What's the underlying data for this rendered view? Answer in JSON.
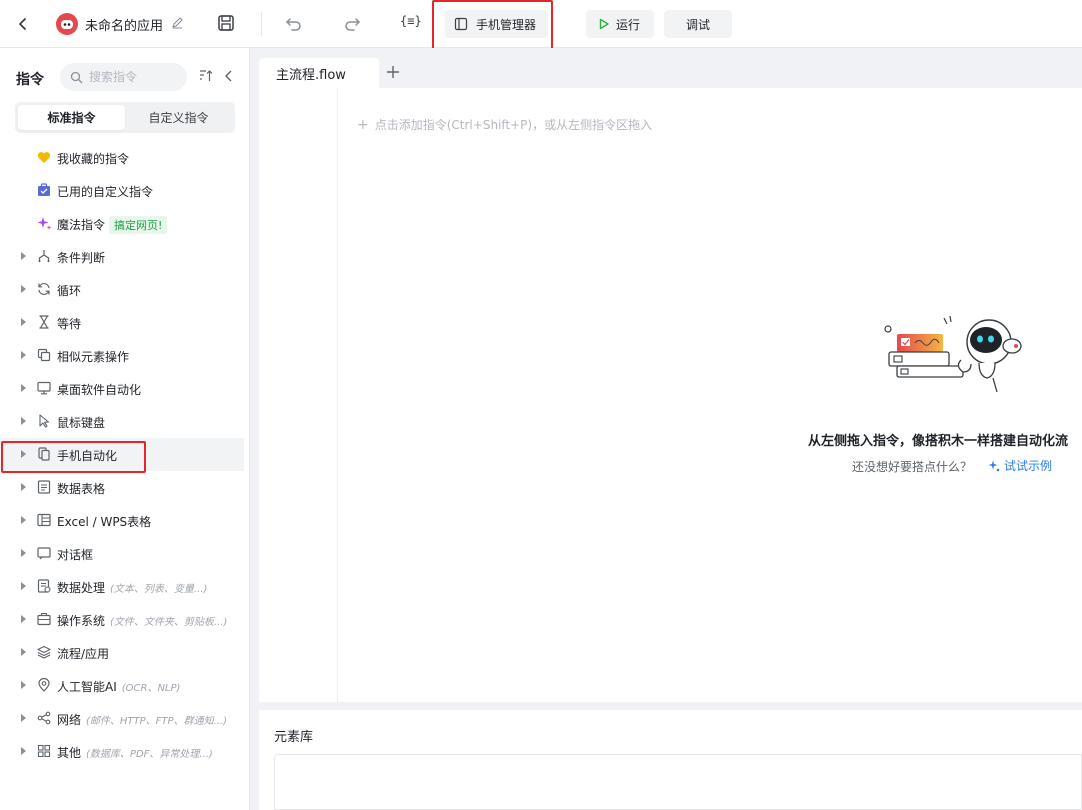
{
  "toolbar": {
    "app_title": "未命名的应用",
    "variables_label": "{≡}",
    "phone_manager_label": "手机管理器",
    "run_label": "运行",
    "debug_label": "调试"
  },
  "sidebar": {
    "title": "指令",
    "search_placeholder": "搜索指令",
    "tabs": [
      "标准指令",
      "自定义指令"
    ],
    "items": [
      {
        "label": "我收藏的指令",
        "icon": "heart-icon"
      },
      {
        "label": "已用的自定义指令",
        "icon": "briefcase-icon"
      },
      {
        "label": "魔法指令",
        "icon": "sparkle-icon",
        "badge": "搞定网页!"
      },
      {
        "label": "条件判断",
        "icon": "branch-icon"
      },
      {
        "label": "循环",
        "icon": "loop-icon"
      },
      {
        "label": "等待",
        "icon": "hourglass-icon"
      },
      {
        "label": "相似元素操作",
        "icon": "copy-icon"
      },
      {
        "label": "桌面软件自动化",
        "icon": "monitor-icon"
      },
      {
        "label": "鼠标键盘",
        "icon": "cursor-icon"
      },
      {
        "label": "手机自动化",
        "icon": "phone-copy-icon"
      },
      {
        "label": "数据表格",
        "icon": "document-icon"
      },
      {
        "label": "Excel / WPS表格",
        "icon": "excel-icon"
      },
      {
        "label": "对话框",
        "icon": "dialog-icon"
      },
      {
        "label": "数据处理",
        "icon": "data-icon",
        "hint": "(文本、列表、变量...)"
      },
      {
        "label": "操作系统",
        "icon": "toolbox-icon",
        "hint": "(文件、文件夹、剪贴板...)"
      },
      {
        "label": "流程/应用",
        "icon": "layers-icon"
      },
      {
        "label": "人工智能AI",
        "icon": "ai-icon",
        "hint": "(OCR、NLP)"
      },
      {
        "label": "网络",
        "icon": "share-icon",
        "hint": "(邮件、HTTP、FTP、群通知...)"
      },
      {
        "label": "其他",
        "icon": "grid-icon",
        "hint": "(数据库、PDF、异常处理...)"
      }
    ]
  },
  "editor": {
    "tab_label": "主流程.flow",
    "add_hint": "点击添加指令(Ctrl+Shift+P)，或从左侧指令区拖入",
    "empty_title": "从左侧拖入指令，像搭积木一样搭建自动化流",
    "empty_sub": "还没想好要搭点什么？",
    "try_label": "试试示例"
  },
  "element_library": {
    "title": "元素库"
  },
  "colors": {
    "accent_red": "#e5252a",
    "run_green": "#2fb344",
    "link_blue": "#2b7de9",
    "logo_red": "#e5484d"
  }
}
